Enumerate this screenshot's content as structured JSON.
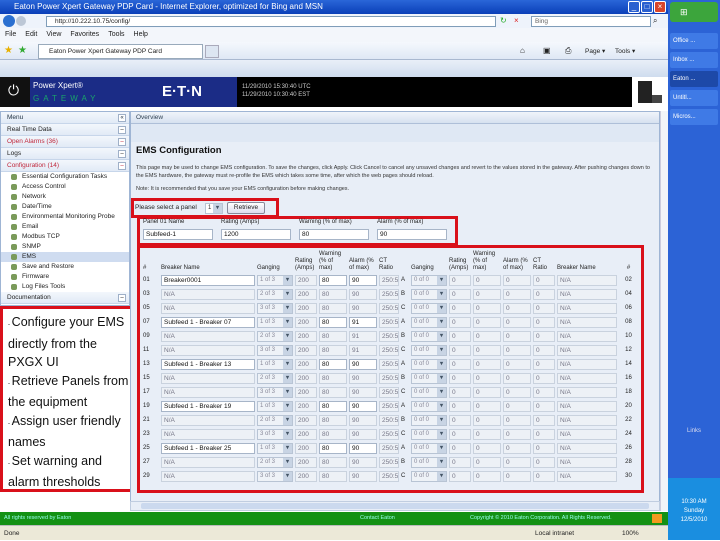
{
  "window": {
    "title": "Eaton Power Xpert Gateway PDP Card - Internet Explorer, optimized for Bing and MSN",
    "url": "http://10.222.10.75/config/",
    "search_placeholder": "Bing",
    "tab": "Eaton Power Xpert Gateway PDP Card",
    "menu": [
      "File",
      "Edit",
      "View",
      "Favorites",
      "Tools",
      "Help"
    ],
    "cmd": [
      "Page ▾",
      "Tools ▾"
    ]
  },
  "banner": {
    "product": "Power Xpert®",
    "sub": "GATEWAY",
    "brand": "E·T·N",
    "time1": "11/29/2010 15:30:40 UTC",
    "time2": "11/29/2010 10:30:40 EST"
  },
  "sidebar": {
    "menu": "Menu",
    "items": [
      "Real Time Data",
      "Open Alarms (36)",
      "Logs",
      "Configuration (14)"
    ],
    "tree": [
      "Essential Configuration Tasks",
      "Access Control",
      "Network",
      "Date/Time",
      "Environmental Monitoring Probe",
      "Email",
      "Modbus TCP",
      "SNMP",
      "EMS",
      "Save and Restore",
      "Firmware",
      "Log Files Tools"
    ],
    "documentation": "Documentation"
  },
  "callout": [
    "Configure your EMS directly from the PXGX UI",
    "Retrieve Panels from the equipment",
    "Assign user friendly names",
    "Set warning and alarm thresholds"
  ],
  "main": {
    "tab": "Overview",
    "title": "EMS Configuration",
    "desc": "This page may be used to change EMS configuration. To save the changes, click Apply. Click Cancel to cancel any unsaved changes and revert to the values stored in the gateway. After pushing changes down to the EMS hardware, the gateway must re-profile the EMS which takes some time, after which the web pages should reload.",
    "note": "Note: It is recommended that you save your EMS configuration before making changes.",
    "select_label": "Please select a panel",
    "panel_value": "1",
    "retrieve": "Retrieve",
    "panel_headers": [
      "Panel 01 Name",
      "Rating (Amps)",
      "Warning (% of max)",
      "Alarm (% of max)"
    ],
    "panel_values": [
      "Subfeed-1",
      "1200",
      "80",
      "90"
    ],
    "headers": [
      "#",
      "Breaker Name",
      "Ganging",
      "Rating (Amps)",
      "Warning (% of max)",
      "Alarm (% of max)",
      "CT Ratio",
      "",
      "Ganging",
      "Rating (Amps)",
      "Warning (% of max)",
      "Alarm (% of max)",
      "CT Ratio",
      "Breaker Name",
      "#"
    ],
    "rows": [
      [
        "01",
        "Breaker0001",
        "1 of 3",
        "200",
        "80",
        "90",
        "250:5",
        "A",
        "0 of 0",
        "0",
        "0",
        "0",
        "0",
        "N/A",
        "02"
      ],
      [
        "03",
        "N/A",
        "2 of 3",
        "200",
        "80",
        "90",
        "250:5",
        "B",
        "0 of 0",
        "0",
        "0",
        "0",
        "0",
        "N/A",
        "04"
      ],
      [
        "05",
        "N/A",
        "3 of 3",
        "200",
        "80",
        "90",
        "250:5",
        "C",
        "0 of 0",
        "0",
        "0",
        "0",
        "0",
        "N/A",
        "06"
      ],
      [
        "07",
        "Subfeed 1 - Breaker 07",
        "1 of 3",
        "200",
        "80",
        "91",
        "250:5",
        "A",
        "0 of 0",
        "0",
        "0",
        "0",
        "0",
        "N/A",
        "08"
      ],
      [
        "09",
        "N/A",
        "2 of 3",
        "200",
        "80",
        "91",
        "250:5",
        "B",
        "0 of 0",
        "0",
        "0",
        "0",
        "0",
        "N/A",
        "10"
      ],
      [
        "11",
        "N/A",
        "3 of 3",
        "200",
        "80",
        "91",
        "250:5",
        "C",
        "0 of 0",
        "0",
        "0",
        "0",
        "0",
        "N/A",
        "12"
      ],
      [
        "13",
        "Subfeed 1 - Breaker 13",
        "1 of 3",
        "200",
        "80",
        "90",
        "250:5",
        "A",
        "0 of 0",
        "0",
        "0",
        "0",
        "0",
        "N/A",
        "14"
      ],
      [
        "15",
        "N/A",
        "2 of 3",
        "200",
        "80",
        "90",
        "250:5",
        "B",
        "0 of 0",
        "0",
        "0",
        "0",
        "0",
        "N/A",
        "16"
      ],
      [
        "17",
        "N/A",
        "3 of 3",
        "200",
        "80",
        "90",
        "250:5",
        "C",
        "0 of 0",
        "0",
        "0",
        "0",
        "0",
        "N/A",
        "18"
      ],
      [
        "19",
        "Subfeed 1 - Breaker 19",
        "1 of 3",
        "200",
        "80",
        "90",
        "250:5",
        "A",
        "0 of 0",
        "0",
        "0",
        "0",
        "0",
        "N/A",
        "20"
      ],
      [
        "21",
        "N/A",
        "2 of 3",
        "200",
        "80",
        "90",
        "250:5",
        "B",
        "0 of 0",
        "0",
        "0",
        "0",
        "0",
        "N/A",
        "22"
      ],
      [
        "23",
        "N/A",
        "3 of 3",
        "200",
        "80",
        "90",
        "250:5",
        "C",
        "0 of 0",
        "0",
        "0",
        "0",
        "0",
        "N/A",
        "24"
      ],
      [
        "25",
        "Subfeed 1 - Breaker 25",
        "1 of 3",
        "200",
        "80",
        "90",
        "250:5",
        "A",
        "0 of 0",
        "0",
        "0",
        "0",
        "0",
        "N/A",
        "26"
      ],
      [
        "27",
        "N/A",
        "2 of 3",
        "200",
        "80",
        "90",
        "250:5",
        "B",
        "0 of 0",
        "0",
        "0",
        "0",
        "0",
        "N/A",
        "28"
      ],
      [
        "29",
        "N/A",
        "3 of 3",
        "200",
        "80",
        "90",
        "250:5",
        "C",
        "0 of 0",
        "0",
        "0",
        "0",
        "0",
        "N/A",
        "30"
      ]
    ]
  },
  "footer": {
    "left": "All rights reserved by Eaton",
    "mid": "Contact Eaton",
    "right": "Copyright © 2010 Eaton Corporation. All Rights Reserved."
  },
  "status": {
    "left": "Done",
    "zone": "Local intranet",
    "zoom": "100%"
  },
  "taskbar": {
    "items": [
      "Office ...",
      "Inbox ...",
      "Eaton ...",
      "Untitl...",
      "Micros..."
    ],
    "links": "Links",
    "time": "10:30 AM",
    "day": "Sunday",
    "date": "12/5/2010"
  }
}
